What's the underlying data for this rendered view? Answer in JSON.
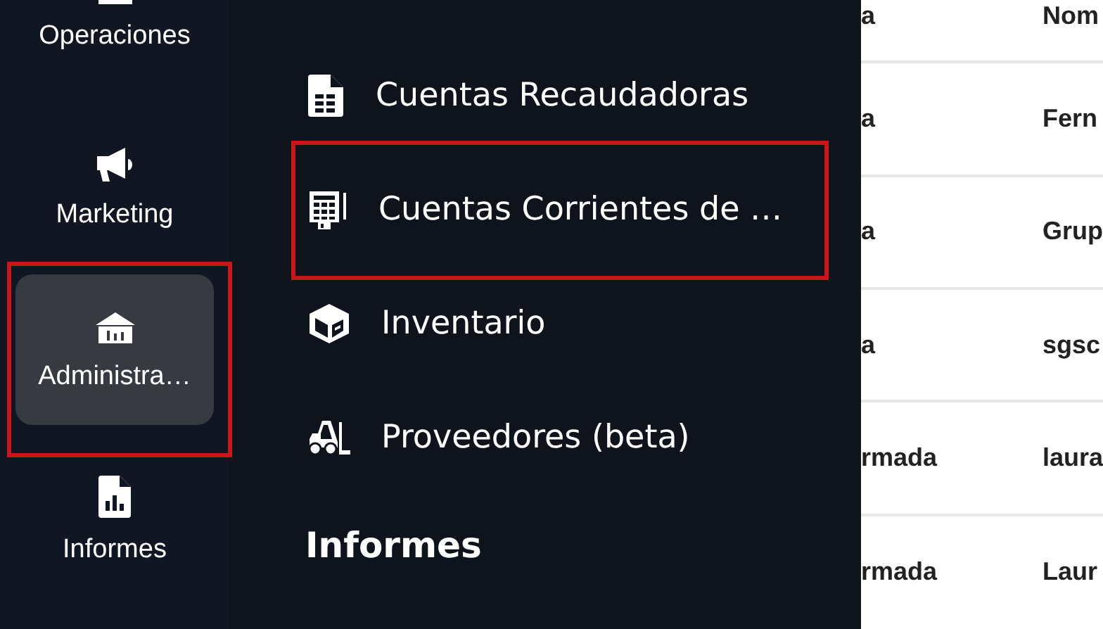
{
  "rail": {
    "items": [
      {
        "label": "Operaciones",
        "selected": false,
        "highlighted": false
      },
      {
        "label": "Marketing",
        "selected": false,
        "highlighted": false
      },
      {
        "label": "Administra…",
        "selected": true,
        "highlighted": true
      },
      {
        "label": "Informes",
        "selected": false,
        "highlighted": false
      }
    ]
  },
  "submenu": {
    "items": [
      {
        "label": "Cuentas Recaudadoras",
        "highlighted": false
      },
      {
        "label": "Cuentas Corrientes de …",
        "highlighted": true
      },
      {
        "label": "Inventario",
        "highlighted": false
      },
      {
        "label": "Proveedores (beta)",
        "highlighted": false
      }
    ],
    "section_heading": "Informes"
  },
  "table": {
    "columns": [
      "a",
      "Nom"
    ],
    "rows": [
      [
        "a",
        "Fern"
      ],
      [
        "a",
        "Grup"
      ],
      [
        "a",
        "sgsc"
      ],
      [
        "rmada",
        "laura"
      ],
      [
        "rmada",
        "Laur"
      ]
    ]
  }
}
